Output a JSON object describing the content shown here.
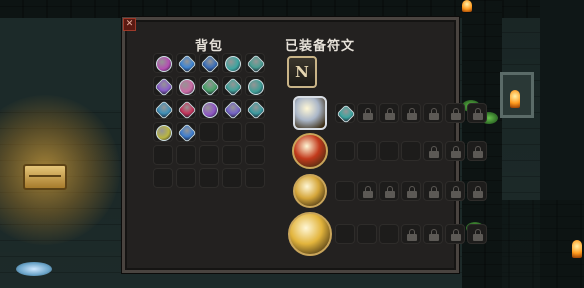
{
  "panel": {
    "close_label": "",
    "bag_title": "背包",
    "equipped_title": "已装备符文",
    "badge_letter": "N"
  },
  "inventory": [
    {
      "icon": "magenta-key-icon",
      "color": "#b44fb2"
    },
    {
      "icon": "blue-crystal-icon",
      "color": "#3f86d4"
    },
    {
      "icon": "blue-scroll-icon",
      "color": "#3c6fb8"
    },
    {
      "icon": "teal-gem-icon",
      "color": "#3da5a0"
    },
    {
      "icon": "teal-flower-gem-icon",
      "color": "#4a9e93"
    },
    {
      "icon": "purple-gem-icon",
      "color": "#8a5fc9"
    },
    {
      "icon": "pink-gem-icon",
      "color": "#c96aa4"
    },
    {
      "icon": "green-leaf-gem-icon",
      "color": "#4aa36a"
    },
    {
      "icon": "teal-leaf-gem-icon",
      "color": "#44a39b"
    },
    {
      "icon": "teal-cross-gem-icon",
      "color": "#3d9c95"
    },
    {
      "icon": "teal-blue-gem-icon",
      "color": "#3e8fb7"
    },
    {
      "icon": "red-crystal-icon",
      "color": "#c4345b"
    },
    {
      "icon": "purple-flower-gem-icon",
      "color": "#8e56c4"
    },
    {
      "icon": "violet-gem-icon",
      "color": "#7463c7"
    },
    {
      "icon": "teal-shield-gem-icon",
      "color": "#3a9aa0"
    },
    {
      "icon": "yellow-ring-gem-icon",
      "color": "#b9b542"
    },
    {
      "icon": "blue-shard-icon",
      "color": "#3f7fd0"
    },
    {
      "icon": "",
      "color": ""
    },
    {
      "icon": "",
      "color": ""
    },
    {
      "icon": "",
      "color": ""
    },
    {
      "icon": "",
      "color": ""
    },
    {
      "icon": "",
      "color": ""
    },
    {
      "icon": "",
      "color": ""
    },
    {
      "icon": "",
      "color": ""
    },
    {
      "icon": "",
      "color": ""
    },
    {
      "icon": "",
      "color": ""
    },
    {
      "icon": "",
      "color": ""
    },
    {
      "icon": "",
      "color": ""
    },
    {
      "icon": "",
      "color": ""
    },
    {
      "icon": "",
      "color": ""
    }
  ],
  "equipped_rows": [
    {
      "rune_icon": "silver-cube-rune-icon",
      "rune_color": "#aab6c8",
      "slots": [
        "teal-gem-icon",
        "locked",
        "locked",
        "locked",
        "locked",
        "locked",
        "locked"
      ]
    },
    {
      "rune_icon": "red-orb-rune-icon",
      "rune_color": "#c23a1c",
      "slots": [
        "empty",
        "empty",
        "empty",
        "empty",
        "locked",
        "locked",
        "locked"
      ]
    },
    {
      "rune_icon": "gold-winged-rune-icon",
      "rune_color": "#d5a63a",
      "slots": [
        "empty",
        "locked",
        "locked",
        "locked",
        "locked",
        "locked",
        "locked"
      ]
    },
    {
      "rune_icon": "gold-hammer-rune-icon",
      "rune_color": "#e2b43c",
      "slots": [
        "empty",
        "empty",
        "empty",
        "locked",
        "locked",
        "locked",
        "locked"
      ]
    }
  ],
  "colors": {
    "panel_bg": "#232120",
    "panel_border": "#4a4440",
    "title_text": "#e7e2da"
  }
}
